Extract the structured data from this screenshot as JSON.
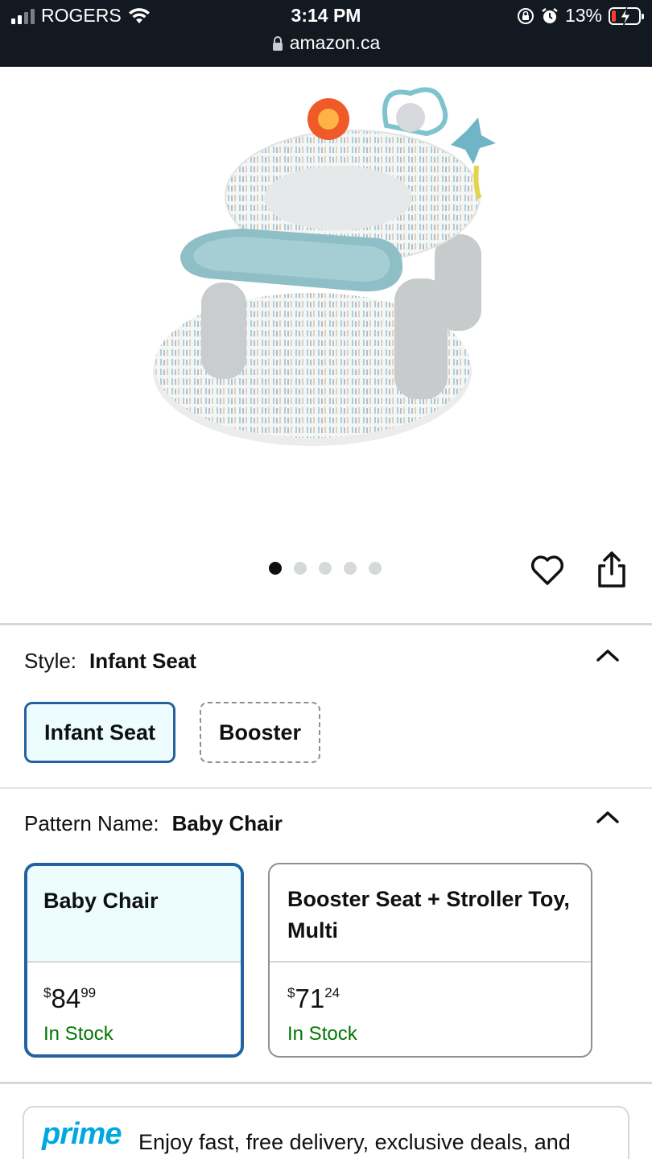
{
  "status_bar": {
    "carrier": "ROGERS",
    "time": "3:14 PM",
    "url": "amazon.ca",
    "battery_percent": "13%",
    "battery_level": 0.13,
    "icons": [
      "signal-icon",
      "wifi-icon",
      "lock-icon",
      "orientation-lock-icon",
      "alarm-icon",
      "battery-charging-icon"
    ]
  },
  "gallery": {
    "image_alt": "Infant seat product image",
    "dot_count": 5,
    "active_index": 0,
    "icons": [
      "heart-icon",
      "share-icon"
    ]
  },
  "style": {
    "label": "Style:",
    "selected_value": "Infant Seat",
    "options": [
      {
        "label": "Infant Seat",
        "state": "selected"
      },
      {
        "label": "Booster",
        "state": "unavailable"
      }
    ]
  },
  "pattern": {
    "label": "Pattern Name:",
    "selected_value": "Baby Chair",
    "options": [
      {
        "name": "Baby Chair",
        "currency": "$",
        "dollars": "84",
        "cents": "99",
        "availability": "In Stock",
        "state": "selected"
      },
      {
        "name": "Booster Seat + Stroller Toy, Multi",
        "currency": "$",
        "dollars": "71",
        "cents": "24",
        "availability": "In Stock",
        "state": "available"
      }
    ]
  },
  "prime": {
    "logo": "prime",
    "text": "Enjoy fast, free delivery, exclusive deals, and"
  },
  "colors": {
    "status_bar_bg": "#131921",
    "selected_border": "#2162a1",
    "selected_bg": "#edfdff",
    "in_stock": "#007600",
    "prime_blue": "#00a8e1"
  }
}
